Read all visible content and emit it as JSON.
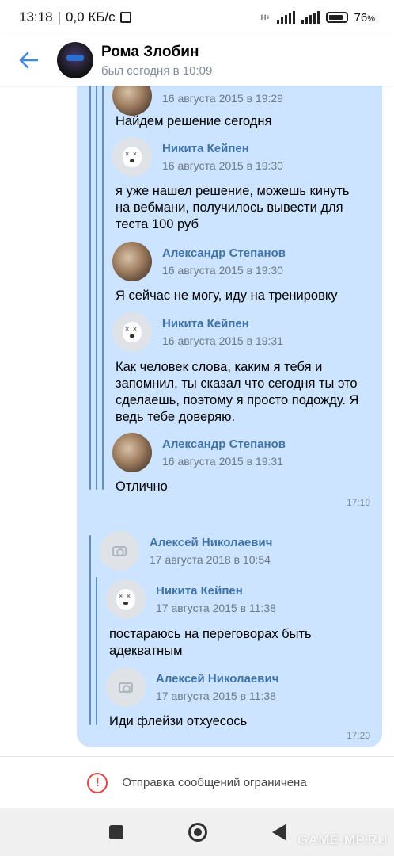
{
  "status_bar": {
    "time": "13:18",
    "network_speed": "0,0 КБ/с",
    "battery": "76",
    "battery_unit": "%",
    "net_type": "H+"
  },
  "header": {
    "name": "Рома Злобин",
    "status": "был сегодня в 10:09"
  },
  "message1": {
    "time": "17:19",
    "forwarded": [
      {
        "author": "",
        "date": "16 августа 2015 в 19:29",
        "text": "Найдем решение сегодня",
        "avatar": "photo"
      },
      {
        "author": "Никита Кейпен",
        "date": "16 августа 2015 в 19:30",
        "text": "я уже нашел решение, можешь кинуть на вебмани, получилось вывести для теста 100 руб",
        "avatar": "dog"
      },
      {
        "author": "Александр Степанов",
        "date": "16 августа 2015 в 19:30",
        "text": "Я сейчас не могу, иду на тренировку",
        "avatar": "photo"
      },
      {
        "author": "Никита Кейпен",
        "date": "16 августа 2015 в 19:31",
        "text": "Как человек слова, каким я тебя и запомнил, ты сказал что сегодня ты это сделаешь, поэтому я просто подожду. Я ведь тебе доверяю.",
        "avatar": "dog"
      },
      {
        "author": "Александр Степанов",
        "date": "16 августа 2015 в 19:31",
        "text": "Отлично",
        "avatar": "photo"
      }
    ]
  },
  "message2": {
    "time": "17:20",
    "outer": {
      "author": "Алексей Николаевич",
      "date": "17 августа 2018 в 10:54",
      "avatar": "camera"
    },
    "forwarded": [
      {
        "author": "Никита Кейпен",
        "date": "17 августа 2015 в 11:38",
        "text": "постараюсь на переговорах быть адекватным",
        "avatar": "dog"
      },
      {
        "author": "Алексей Николаевич",
        "date": "17 августа 2015 в 11:38",
        "text": "Иди флейзи отхуесось",
        "avatar": "camera"
      }
    ]
  },
  "footer": {
    "notice": "Отправка сообщений ограничена",
    "icon": "exclamation-circle-icon"
  },
  "watermark": "GAME-MP.RU",
  "colors": {
    "bubble": "#cce4ff",
    "accent": "#3f73a8",
    "back_arrow": "#3f8ae0",
    "warning": "#e64646"
  }
}
